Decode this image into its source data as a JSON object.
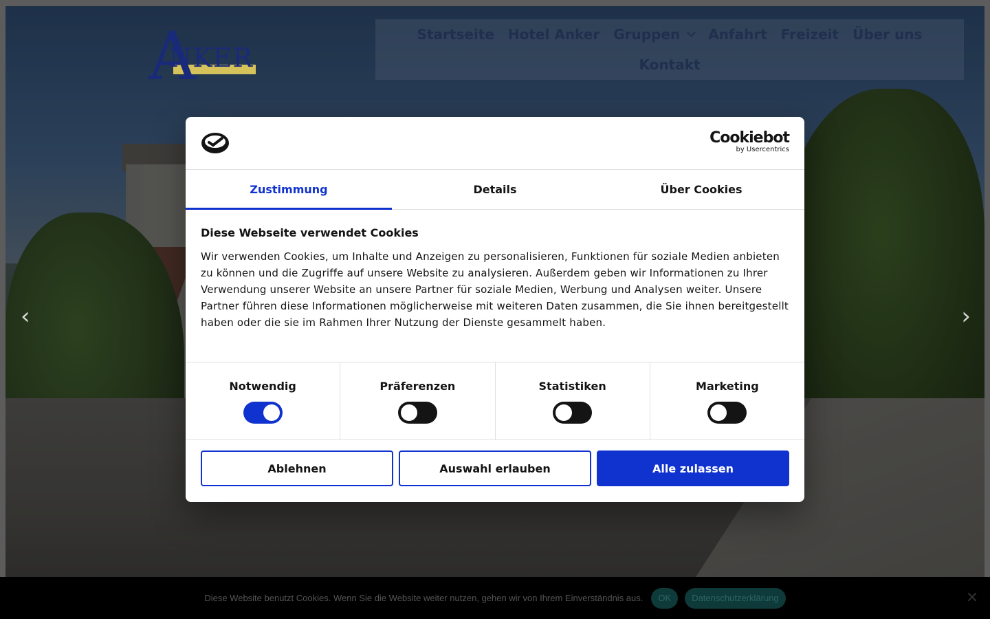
{
  "site": {
    "logo_text": "NKER",
    "logo_letter": "A"
  },
  "nav": {
    "row1": [
      {
        "label": "Startseite"
      },
      {
        "label": "Hotel Anker"
      },
      {
        "label": "Gruppen",
        "has_dropdown": true
      },
      {
        "label": "Anfahrt"
      },
      {
        "label": "Freizeit"
      },
      {
        "label": "Über uns"
      }
    ],
    "row2": [
      {
        "label": "Kontakt"
      }
    ]
  },
  "slider": {
    "prev_icon": "chevron-left-icon",
    "next_icon": "chevron-right-icon"
  },
  "cookie_modal": {
    "brand_main": "Cookiebot",
    "brand_sub": "by Usercentrics",
    "tabs": [
      {
        "label": "Zustimmung",
        "active": true
      },
      {
        "label": "Details",
        "active": false
      },
      {
        "label": "Über Cookies",
        "active": false
      }
    ],
    "heading": "Diese Webseite verwendet Cookies",
    "body": "Wir verwenden Cookies, um Inhalte und Anzeigen zu personalisieren, Funktionen für soziale Medien anbieten zu können und die Zugriffe auf unsere Website zu analysieren. Außerdem geben wir Informationen zu Ihrer Verwendung unserer Website an unsere Partner für soziale Medien, Werbung und Analysen weiter. Unsere Partner führen diese Informationen möglicherweise mit weiteren Daten zusammen, die Sie ihnen bereitgestellt haben oder die sie im Rahmen Ihrer Nutzung der Dienste gesammelt haben.",
    "toggles": [
      {
        "label": "Notwendig",
        "on": true
      },
      {
        "label": "Präferenzen",
        "on": false
      },
      {
        "label": "Statistiken",
        "on": false
      },
      {
        "label": "Marketing",
        "on": false
      }
    ],
    "buttons": {
      "reject": "Ablehnen",
      "allow_selection": "Auswahl erlauben",
      "allow_all": "Alle zulassen"
    },
    "colors": {
      "accent": "#1032cf",
      "text": "#141414"
    }
  },
  "cookie_bar": {
    "message": "Diese Website benutzt Cookies. Wenn Sie die Website weiter nutzen, gehen wir von Ihrem Einverständnis aus.",
    "ok_label": "OK",
    "privacy_label": "Datenschutzerklärung"
  }
}
